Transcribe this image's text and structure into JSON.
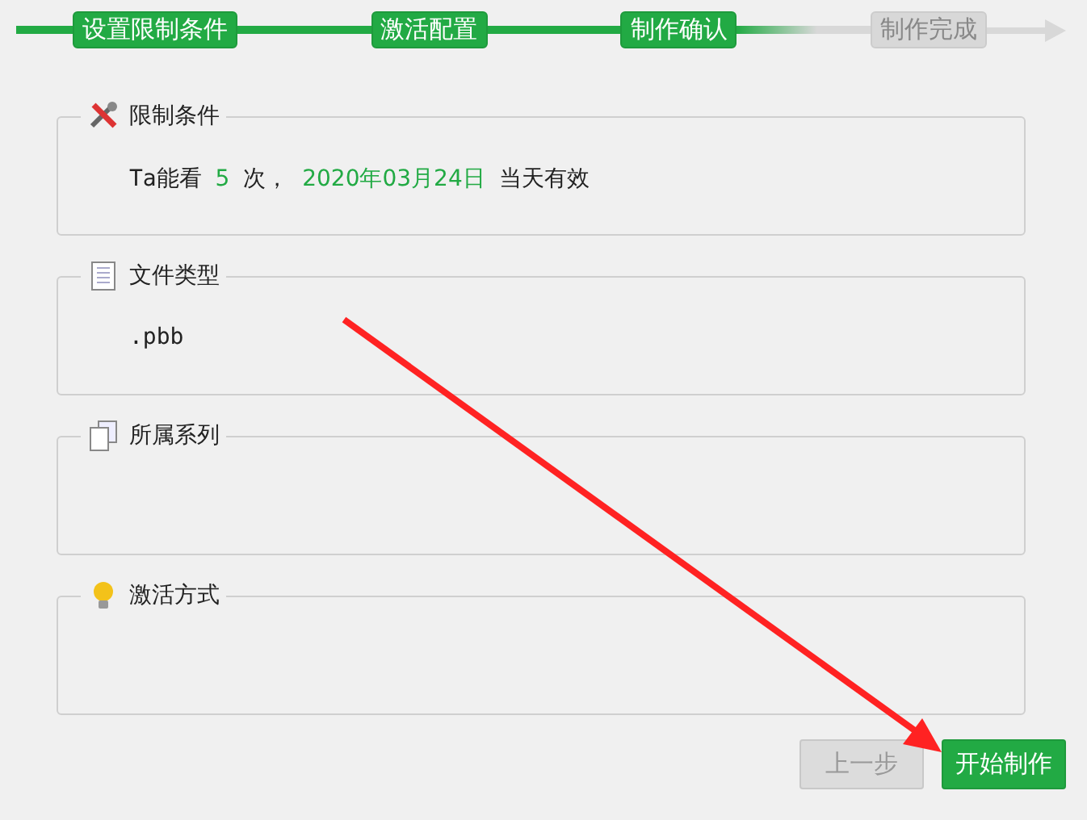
{
  "steps": [
    {
      "label": "设置限制条件",
      "done": true
    },
    {
      "label": "激活配置",
      "done": true
    },
    {
      "label": "制作确认",
      "done": true
    },
    {
      "label": "制作完成",
      "done": false
    }
  ],
  "sections": [
    {
      "title": "限制条件",
      "segments": [
        {
          "text": "Ta能看",
          "highlight": false
        },
        {
          "text": "5",
          "highlight": true
        },
        {
          "text": "次，",
          "highlight": false
        },
        {
          "text": "2020年03月24日",
          "highlight": true
        },
        {
          "text": "当天有效",
          "highlight": false
        }
      ]
    },
    {
      "title": "文件类型",
      "segments": [
        {
          "text": ".pbb",
          "highlight": false
        }
      ]
    },
    {
      "title": "所属系列"
    },
    {
      "title": "激活方式"
    }
  ],
  "buttons": [
    {
      "label": "上一步",
      "disabled": true
    },
    {
      "label": "开始制作",
      "disabled": false
    }
  ],
  "annotation": {
    "kind": "arrow"
  }
}
